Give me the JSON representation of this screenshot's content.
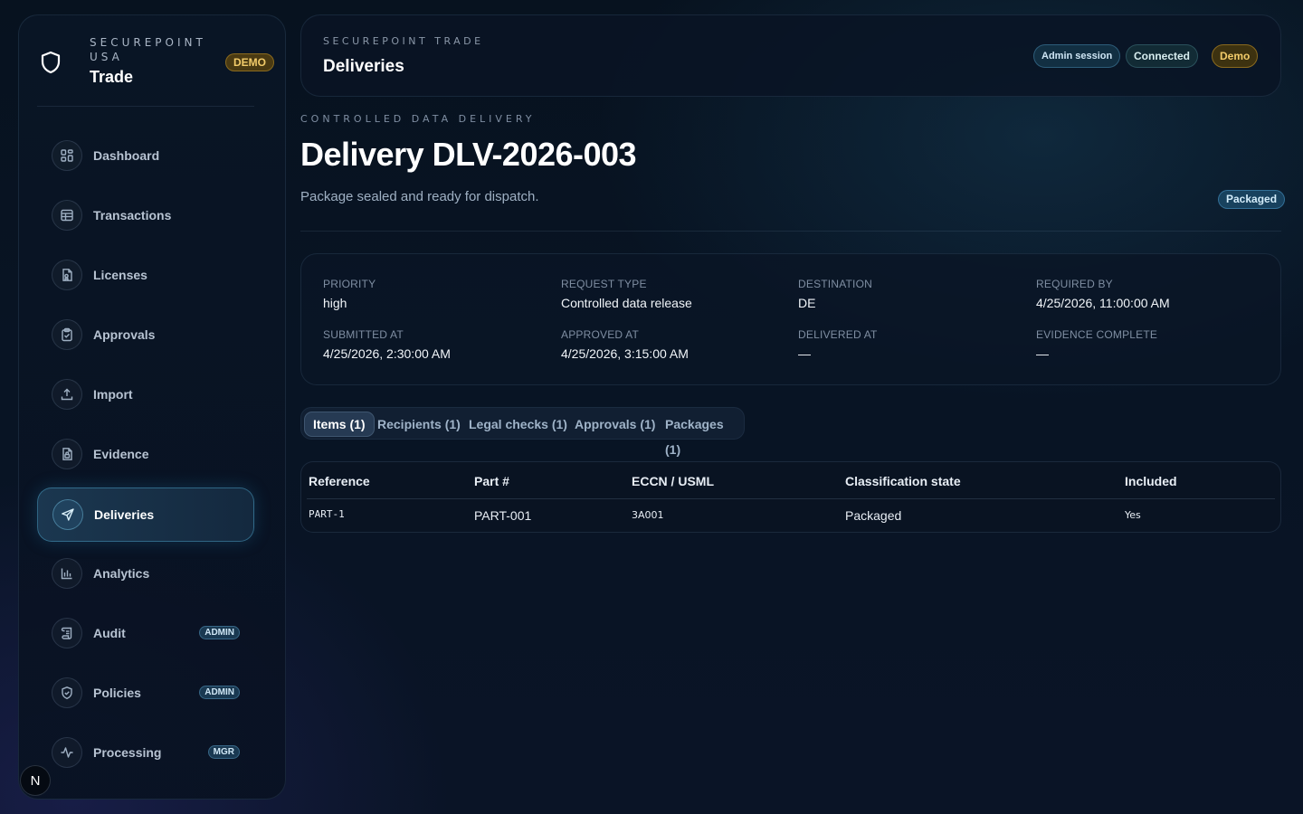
{
  "brand": {
    "org_line1": "SECUREPOINT",
    "org_line2": "USA",
    "title": "Trade",
    "demo_badge": "DEMO"
  },
  "sidebar": {
    "items": [
      {
        "label": "Dashboard",
        "icon": "grid-icon"
      },
      {
        "label": "Transactions",
        "icon": "table-icon"
      },
      {
        "label": "Licenses",
        "icon": "license-doc-icon"
      },
      {
        "label": "Approvals",
        "icon": "clipboard-check-icon"
      },
      {
        "label": "Import",
        "icon": "upload-icon"
      },
      {
        "label": "Evidence",
        "icon": "file-lock-icon"
      },
      {
        "label": "Deliveries",
        "icon": "send-icon",
        "active": true
      },
      {
        "label": "Analytics",
        "icon": "bar-chart-icon"
      },
      {
        "label": "Audit",
        "icon": "scroll-icon",
        "badge": "ADMIN"
      },
      {
        "label": "Policies",
        "icon": "shield-check-icon",
        "badge": "ADMIN"
      },
      {
        "label": "Processing",
        "icon": "activity-icon",
        "badge": "MGR"
      }
    ],
    "bottom_avatar": "N"
  },
  "header": {
    "org": "SECUREPOINT TRADE",
    "title": "Deliveries",
    "pills": {
      "admin": "Admin session",
      "connected": "Connected",
      "demo": "Demo"
    }
  },
  "page": {
    "eyebrow": "CONTROLLED DATA DELIVERY",
    "title": "Delivery DLV-2026-003",
    "subtitle": "Package sealed and ready for dispatch.",
    "status": "Packaged"
  },
  "details": {
    "priority": {
      "label": "Priority",
      "value": "high"
    },
    "request_type": {
      "label": "Request type",
      "value": "Controlled data release"
    },
    "destination": {
      "label": "Destination",
      "value": "DE"
    },
    "required_by": {
      "label": "Required by",
      "value": "4/25/2026, 11:00:00 AM"
    },
    "submitted_at": {
      "label": "Submitted at",
      "value": "4/25/2026, 2:30:00 AM"
    },
    "approved_at": {
      "label": "Approved at",
      "value": "4/25/2026, 3:15:00 AM"
    },
    "delivered_at": {
      "label": "Delivered at",
      "value": "—"
    },
    "evidence_complete": {
      "label": "Evidence complete",
      "value": "—"
    }
  },
  "tabs": [
    "Items (1)",
    "Recipients (1)",
    "Legal checks (1)",
    "Approvals (1)",
    "Packages (1)"
  ],
  "table": {
    "columns": [
      "Reference",
      "Part #",
      "ECCN / USML",
      "Classification state",
      "Included"
    ],
    "rows": [
      [
        "PART-1",
        "PART-001",
        "3A001",
        "Packaged",
        "Yes"
      ]
    ]
  },
  "colors": {
    "accent": "#2f9fd0",
    "demo": "#f3cc6a",
    "background": "#081424"
  }
}
